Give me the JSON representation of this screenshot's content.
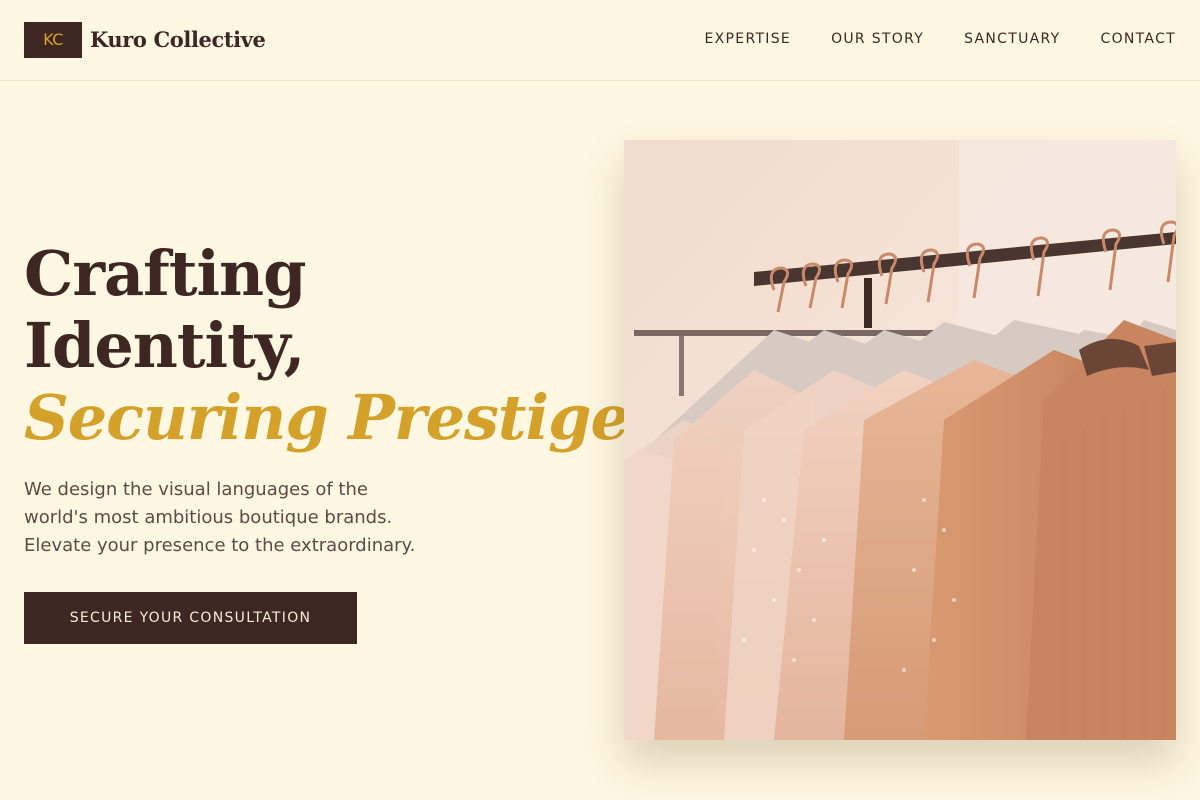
{
  "header": {
    "logo_initials": "KC",
    "brand": "Kuro Collective",
    "nav": [
      {
        "label": "EXPERTISE"
      },
      {
        "label": "OUR STORY"
      },
      {
        "label": "SANCTUARY"
      },
      {
        "label": "CONTACT"
      }
    ]
  },
  "hero": {
    "headline_line1": "Crafting",
    "headline_line2": "Identity,",
    "headline_accent": "Securing Prestige.",
    "lede_line1": "We design the visual languages of the",
    "lede_line2": "world's most ambitious boutique brands.",
    "lede_line3": "Elevate your presence to the extraordinary.",
    "cta_label": "SECURE YOUR CONSULTATION",
    "image": "boutique-clothing-rack"
  },
  "colors": {
    "background": "#fef7e1",
    "primary": "#3e2723",
    "accent": "#d4a12a"
  }
}
